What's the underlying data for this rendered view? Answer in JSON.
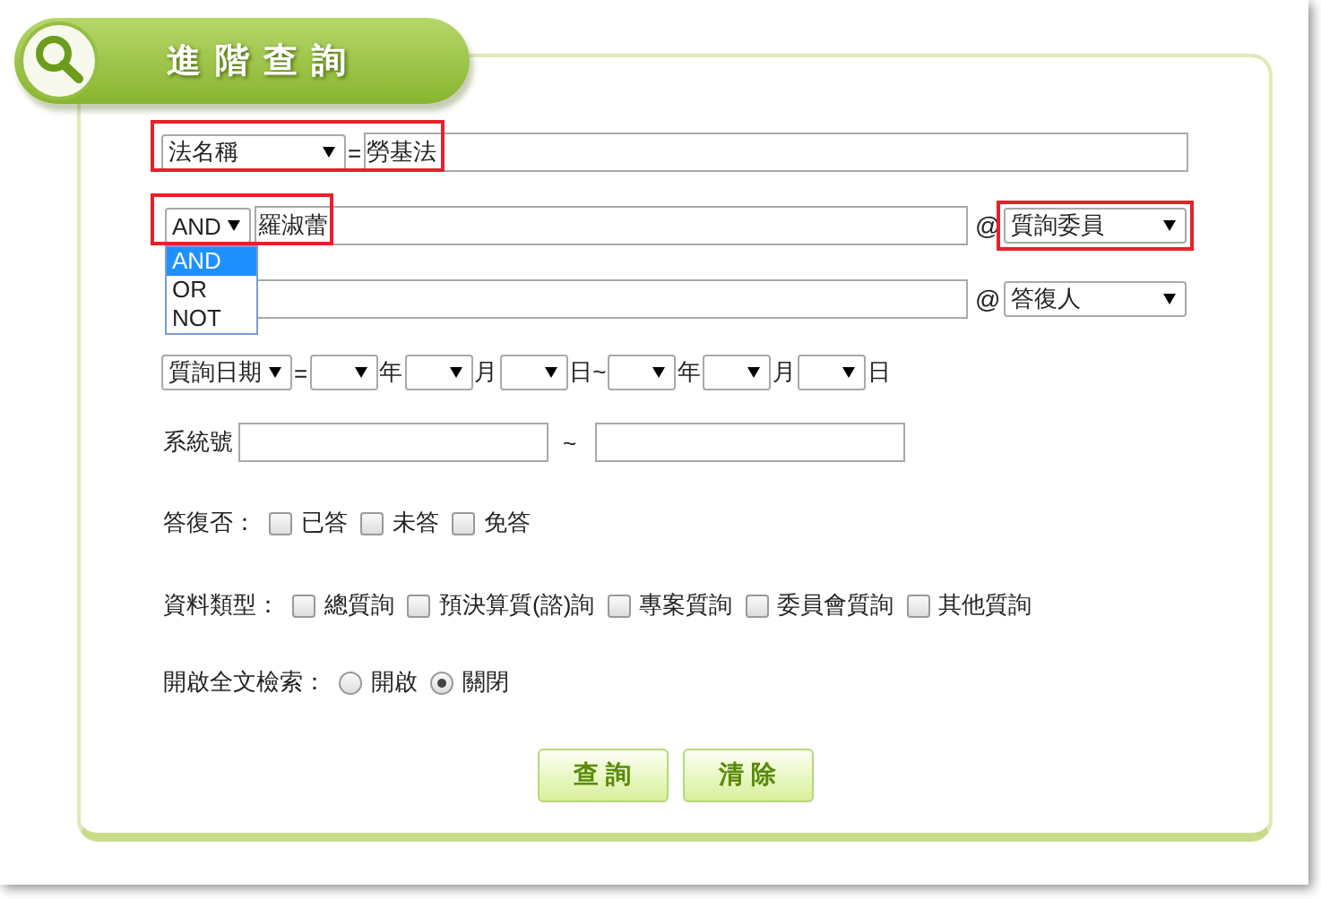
{
  "header": {
    "title": "進階查詢"
  },
  "law_row": {
    "field_select": "法名稱",
    "operator": "=",
    "value": "勞基法",
    "highlighted": true
  },
  "keyword_rows": [
    {
      "logic_select": "AND",
      "logic_highlighted": true,
      "value": "羅淑蕾",
      "at": "@",
      "role_select": "質詢委員",
      "role_highlighted": true
    },
    {
      "at": "@",
      "role_select": "答復人",
      "role_highlighted": false
    }
  ],
  "logic_dropdown": {
    "options": [
      {
        "label": "AND",
        "selected": true
      },
      {
        "label": "OR",
        "selected": false
      },
      {
        "label": "NOT",
        "selected": false
      }
    ]
  },
  "date_row": {
    "field_select": "質詢日期",
    "operator": "=",
    "units": [
      "年",
      "月",
      "日~",
      "年",
      "月",
      "日"
    ]
  },
  "serial_row": {
    "label": "系統號",
    "separator": "~"
  },
  "answered": {
    "label": "答復否：",
    "options": [
      {
        "label": "已答",
        "checked": false
      },
      {
        "label": "未答",
        "checked": false
      },
      {
        "label": "免答",
        "checked": false
      }
    ]
  },
  "types": {
    "label": "資料類型：",
    "options": [
      {
        "label": "總質詢",
        "checked": false
      },
      {
        "label": "預決算質(諮)詢",
        "checked": false
      },
      {
        "label": "專案質詢",
        "checked": false
      },
      {
        "label": "委員會質詢",
        "checked": false
      },
      {
        "label": "其他質詢",
        "checked": false
      }
    ]
  },
  "fulltext": {
    "label": "開啟全文檢索：",
    "options": [
      {
        "label": "開啟",
        "selected": false
      },
      {
        "label": "關閉",
        "selected": true
      }
    ]
  },
  "buttons": [
    "查 詢",
    "清 除"
  ]
}
